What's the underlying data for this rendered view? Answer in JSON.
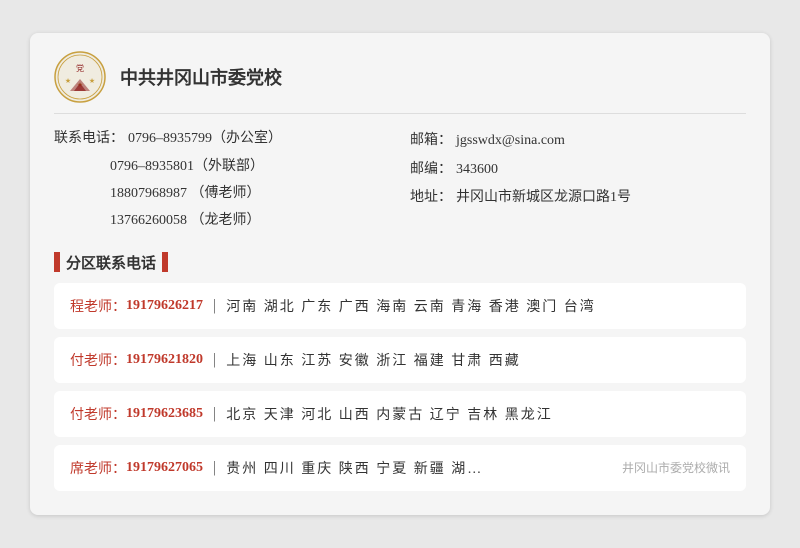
{
  "org": {
    "name": "中共井冈山市委党校",
    "logo_alt": "党校徽章"
  },
  "contacts": {
    "label_phone": "联系电话：",
    "phone1": "0796–8935799（办公室）",
    "phone2": "0796–8935801（外联部）",
    "phone3": "18807968987 （傅老师）",
    "phone4": "13766260058 （龙老师）",
    "label_email": "邮箱：",
    "email": "jgsswdx@sina.com",
    "label_postcode": "邮编：",
    "postcode": "343600",
    "label_address": "地址：",
    "address": "井冈山市新城区龙源口路1号"
  },
  "section_title": "分区联系电话",
  "regions": [
    {
      "teacher": "程老师：",
      "phone": "19179626217",
      "areas": "河南  湖北  广东  广西  海南  云南  青海  香港  澳门  台湾"
    },
    {
      "teacher": "付老师：",
      "phone": "19179621820",
      "areas": "上海  山东  江苏  安徽  浙江  福建  甘肃  西藏"
    },
    {
      "teacher": "付老师：",
      "phone": "19179623685",
      "areas": "北京  天津  河北  山西  内蒙古  辽宁  吉林  黑龙江"
    },
    {
      "teacher": "席老师：",
      "phone": "19179627065",
      "areas": "贵州  四川  重庆  陕西  宁夏  新疆  湖…"
    }
  ],
  "watermark": "井冈山市委党校微讯"
}
